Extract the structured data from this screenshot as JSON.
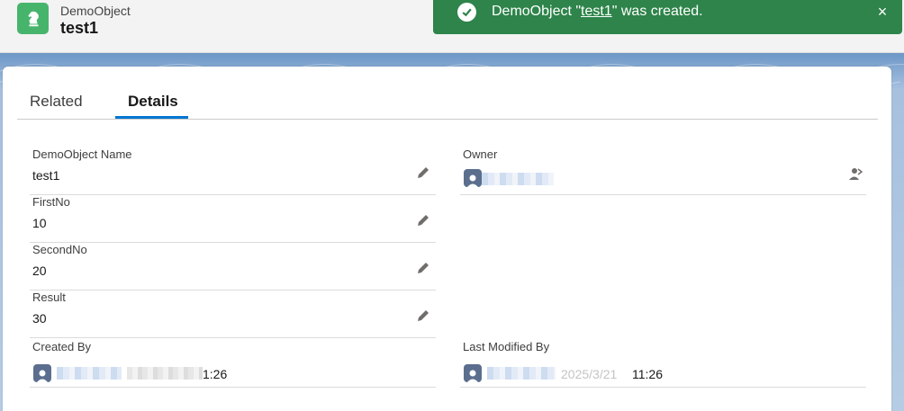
{
  "header": {
    "object_type": "DemoObject",
    "record_name": "test1",
    "icon": "chess-knight-icon"
  },
  "toast": {
    "message_before": "DemoObject \"",
    "record_link": "test1",
    "message_after": "\" was created.",
    "close_glyph": "×",
    "color": "#2e844a"
  },
  "tabs": [
    {
      "label": "Related",
      "active": false
    },
    {
      "label": "Details",
      "active": true
    }
  ],
  "fields": {
    "name": {
      "label": "DemoObject Name",
      "value": "test1"
    },
    "first_no": {
      "label": "FirstNo",
      "value": "10"
    },
    "second_no": {
      "label": "SecondNo",
      "value": "20"
    },
    "result": {
      "label": "Result",
      "value": "30"
    },
    "owner": {
      "label": "Owner"
    },
    "created_by": {
      "label": "Created By",
      "value_tail": "1:26"
    },
    "last_modified_by": {
      "label": "Last Modified By",
      "value_tail": "11:26",
      "date_fragment": "2025/3/21"
    }
  },
  "colors": {
    "accent": "#0176d3",
    "object_icon": "#47b46c"
  }
}
